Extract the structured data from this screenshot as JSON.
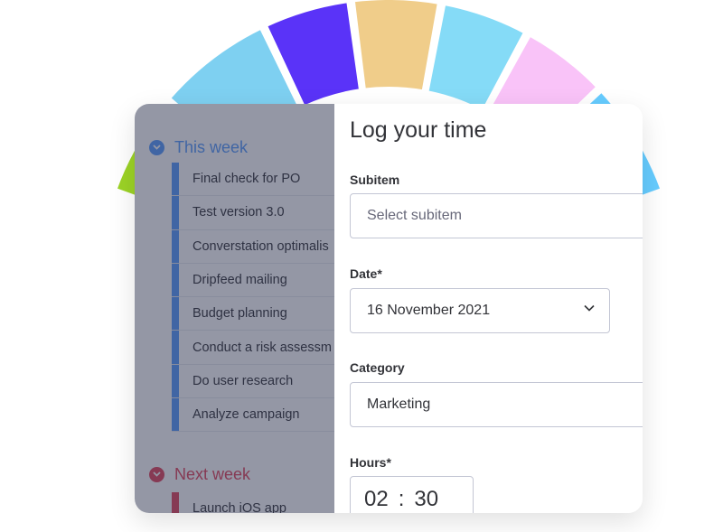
{
  "colors": {
    "this_week": "#579bfc",
    "next_week": "#e2445c",
    "wheel": [
      "#9cd326",
      "#7ed0f1",
      "#5a33f8",
      "#f0cd8a",
      "#85dbf7",
      "#f9c3f8",
      "#66ccff"
    ]
  },
  "groups": {
    "this_week": {
      "title": "This week",
      "tasks": [
        {
          "label": "Final check for PO"
        },
        {
          "label": "Test version 3.0"
        },
        {
          "label": "Converstation optimalis"
        },
        {
          "label": "Dripfeed mailing"
        },
        {
          "label": "Budget planning"
        },
        {
          "label": "Conduct a risk assessm"
        },
        {
          "label": "Do user research"
        },
        {
          "label": "Analyze campaign"
        }
      ]
    },
    "next_week": {
      "title": "Next week",
      "tasks": [
        {
          "label": "Launch iOS app"
        }
      ]
    }
  },
  "form": {
    "title": "Log your time",
    "subitem": {
      "label": "Subitem",
      "placeholder": "Select subitem"
    },
    "date": {
      "label": "Date*",
      "value": "16 November 2021"
    },
    "category": {
      "label": "Category",
      "value": "Marketing"
    },
    "hours": {
      "label": "Hours*",
      "hours": "02",
      "separator": ":",
      "minutes": "30"
    }
  }
}
